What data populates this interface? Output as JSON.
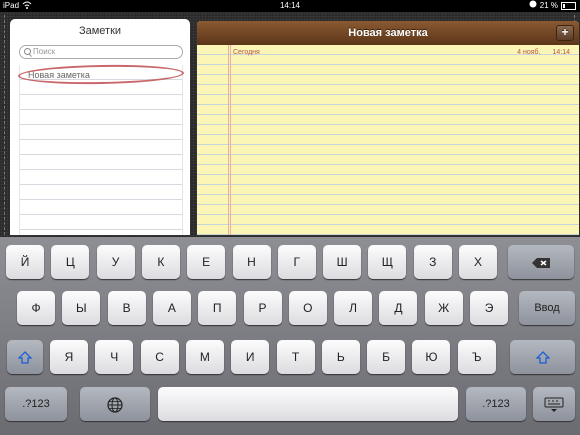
{
  "status": {
    "carrier": "iPad",
    "time": "14:14",
    "battery": "21 %"
  },
  "sidebar": {
    "title": "Заметки",
    "search_placeholder": "Поиск",
    "items": [
      {
        "label": "Новая заметка"
      }
    ]
  },
  "note": {
    "title": "Новая заметка",
    "add_label": "+",
    "date_label": "Сегодня",
    "date": "4 нояб.",
    "time": "14:14"
  },
  "keyboard": {
    "row1": [
      "Й",
      "Ц",
      "У",
      "К",
      "Е",
      "Н",
      "Г",
      "Ш",
      "Щ",
      "З",
      "Х"
    ],
    "row2": [
      "Ф",
      "Ы",
      "В",
      "А",
      "П",
      "Р",
      "О",
      "Л",
      "Д",
      "Ж",
      "Э"
    ],
    "row3": [
      "Я",
      "Ч",
      "С",
      "М",
      "И",
      "Т",
      "Ь",
      "Б",
      "Ю",
      "Ъ"
    ],
    "return": "Ввод",
    "numbers_left": ".?123",
    "numbers_right": ".?123"
  }
}
